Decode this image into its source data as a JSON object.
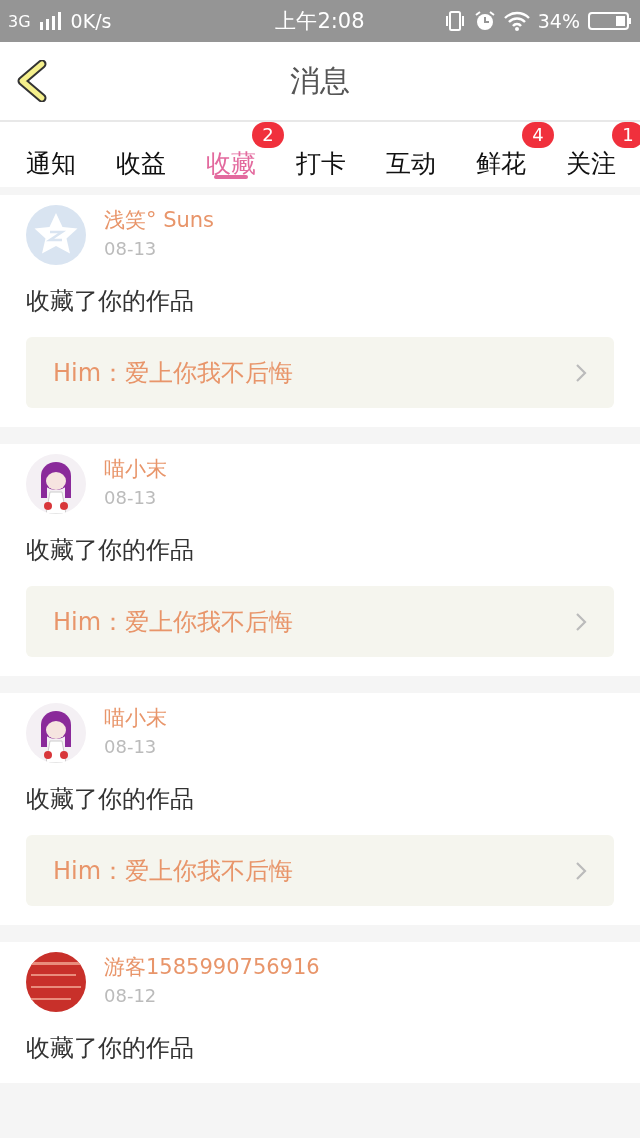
{
  "status_bar": {
    "network": "3G",
    "speed": "0K/s",
    "time": "上午2:08",
    "battery": "34%"
  },
  "header": {
    "title": "消息"
  },
  "tabs": [
    {
      "label": "通知",
      "selected": false
    },
    {
      "label": "收益",
      "selected": false
    },
    {
      "label": "收藏",
      "selected": true,
      "badge": "2"
    },
    {
      "label": "打卡",
      "selected": false
    },
    {
      "label": "互动",
      "selected": false
    },
    {
      "label": "鲜花",
      "selected": false,
      "badge": "4"
    },
    {
      "label": "关注",
      "selected": false,
      "badge": "1"
    }
  ],
  "messages": [
    {
      "kind": "default",
      "name": "浅笑° Suns",
      "date": "08-13",
      "text": "收藏了你的作品",
      "link": "Him：爱上你我不后悔"
    },
    {
      "kind": "picture",
      "name": "喵小末",
      "date": "08-13",
      "text": "收藏了你的作品",
      "link": "Him：爱上你我不后悔"
    },
    {
      "kind": "picture",
      "name": "喵小末",
      "date": "08-13",
      "text": "收藏了你的作品",
      "link": "Him：爱上你我不后悔"
    },
    {
      "kind": "picture",
      "name": "游客1585990756916",
      "date": "08-12",
      "text": "收藏了你的作品"
    }
  ]
}
